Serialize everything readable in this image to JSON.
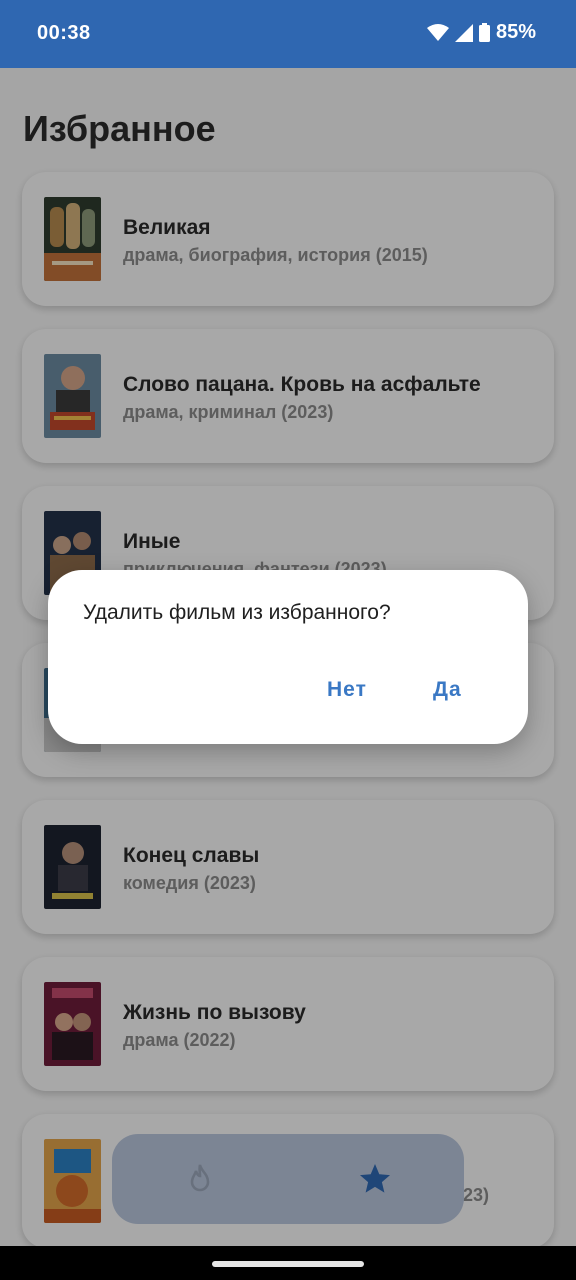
{
  "status_bar": {
    "time": "00:38",
    "battery": "85%",
    "icons": [
      "wifi-icon",
      "signal-icon",
      "battery-icon"
    ]
  },
  "page": {
    "title": "Избранное"
  },
  "movies": [
    {
      "title": "Великая",
      "subtitle": "драма, биография, история (2015)",
      "poster_colors": [
        "#b48a4e",
        "#2f3b2e"
      ]
    },
    {
      "title": "Слово пацана. Кровь на асфальте",
      "subtitle": "драма, криминал (2023)",
      "poster_colors": [
        "#6b8aa0",
        "#c0482c"
      ]
    },
    {
      "title": "Иные",
      "subtitle": "приключения, фантези (2023)",
      "poster_colors": [
        "#233149",
        "#8c6b4a"
      ]
    },
    {
      "title": "",
      "subtitle": "",
      "poster_colors": [
        "#3b6a8a",
        "#c9c9c9"
      ]
    },
    {
      "title": "Конец славы",
      "subtitle": "комедия (2023)",
      "poster_colors": [
        "#1d2330",
        "#8a7d70"
      ]
    },
    {
      "title": "Жизнь по вызову",
      "subtitle": "драма (2022)",
      "poster_colors": [
        "#6d1d3a",
        "#c24a6c"
      ]
    },
    {
      "title": "",
      "subtitle": "23)",
      "poster_colors": [
        "#e0a34a",
        "#2b7fc2"
      ]
    }
  ],
  "dialog": {
    "message": "Удалить фильм из избранного?",
    "no_label": "Нет",
    "yes_label": "Да"
  },
  "bottom_nav": {
    "items": [
      "fire-icon",
      "star-icon"
    ],
    "active": "star-icon",
    "accent": "#2f67b1"
  },
  "colors": {
    "status_bar": "#2f67b1",
    "dialog_button": "#3a78c4"
  }
}
